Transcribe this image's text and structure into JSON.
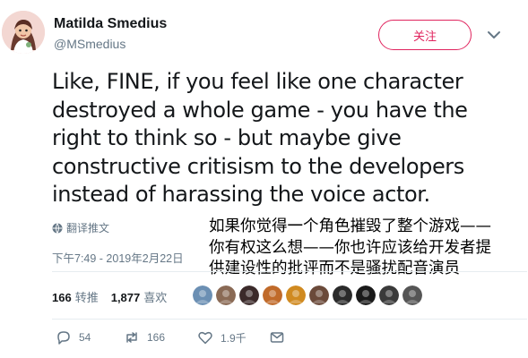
{
  "author": {
    "display_name": "Matilda Smedius",
    "handle": "@MSmedius"
  },
  "follow_button": {
    "label": "关注"
  },
  "tweet": {
    "lines": [
      "Like, FINE, if you feel like one character",
      "destroyed a whole game - you have the",
      "right to think so - but maybe give",
      "constructive critisism to the developers",
      "instead of harassing the voice actor."
    ],
    "translate_label": "翻译推文",
    "timestamp": "下午7:49 - 2019年2月22日"
  },
  "translation_overlay": {
    "lines": [
      "如果你觉得一个角色摧毁了整个游戏——",
      "你有权这么想——你也许应该给开发者提",
      "供建设性的批评而不是骚扰配音演员"
    ]
  },
  "stats": {
    "retweets_count": "166",
    "retweets_label": "转推",
    "likes_count": "1,877",
    "likes_label": "喜欢"
  },
  "liker_avatars": [
    "#6b8fb3",
    "#8a6a55",
    "#3b2a2a",
    "#c06a2a",
    "#d08a20",
    "#6b4a3a",
    "#2a2a2a",
    "#1a1a1a",
    "#3a3a3a",
    "#555555"
  ],
  "actions": {
    "reply_count": "54",
    "retweet_count": "166",
    "like_count": "1.9千"
  },
  "colors": {
    "accent_pink": "#e0245e",
    "secondary_text": "#657786",
    "primary_text": "#14171a"
  }
}
